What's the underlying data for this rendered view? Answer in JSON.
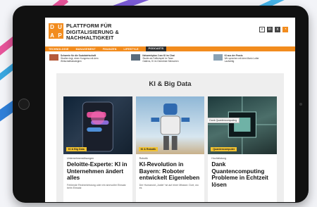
{
  "site": {
    "logo_letters": [
      "D",
      "U",
      "A",
      "P"
    ],
    "title_line1": "PLATTFORM FÜR",
    "title_line2": "DIGITALISIERUNG &",
    "title_line3": "NACHHALTIGKEIT"
  },
  "header_icons": [
    {
      "icon": "search-icon",
      "glyph": "⌕"
    },
    {
      "icon": "linkedin-icon",
      "glyph": "in"
    },
    {
      "icon": "xing-icon",
      "glyph": "x"
    },
    {
      "icon": "rss-icon",
      "glyph": "◔"
    }
  ],
  "nav": {
    "items": [
      "TECHNOLOGIE",
      "MANAGEMENT",
      "FINANZEN",
      "LIFESTYLE",
      "PODCASTS"
    ],
    "active": "PODCASTS"
  },
  "teasers": [
    {
      "title": "Schwerin für die Sozialwirtschaft",
      "text": "Straßen legt, einen Kongress mit dem",
      "extra": "Wirtschaftsstrategien",
      "thumb_color": "#b65a3a"
    },
    {
      "title": "Netzwerkplan 2 am KI im Chat",
      "text": "Studie als Fallbeispiel im Team",
      "extra": "Gatiens, KI im Gemeinde Menschen",
      "thumb_color": "#5a6c7d"
    },
    {
      "title": "KI aus der Praxis",
      "text": "Wir sprechen mit dem Mario Lutter",
      "extra": "Laufzeitig",
      "thumb_color": "#8aa2b4"
    }
  ],
  "main": {
    "section_title": "KI & Big Data"
  },
  "cards": [
    {
      "badge": "KI & Big Data",
      "kicker": "Unternehmenslösungen",
      "title": "Deloitte-Experte: KI in Unternehmen ändert alles",
      "text": "Fehlende Rechenleistung oder ein sinnvoller Einsatz beim Einsatz"
    },
    {
      "badge": "KI & Robotik",
      "kicker": "Robotik",
      "title": "KI-Revolution in Bayern: Roboter entwickelt Eigenleben",
      "text": "Der Humanoid „Justin“ ist auf einer Mission: Dort, wo es"
    },
    {
      "badge": "Quantencomputer",
      "kicker": "Hochleistung",
      "title": "Dank Quantencomputing Probleme in Echtzeit lösen",
      "tooltip": "Dank Quantencomputing"
    }
  ],
  "colors": {
    "brand_orange": "#f28c1e",
    "badge_yellow": "#f2c230",
    "tablet_frame": "#111111"
  }
}
